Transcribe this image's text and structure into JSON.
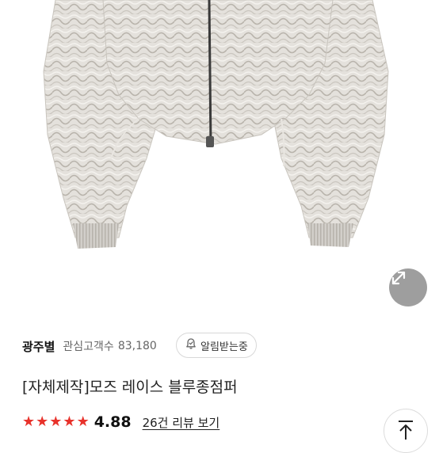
{
  "product_image": {
    "icon": "product-photo"
  },
  "expand_button": {
    "icon": "expand-arrows-icon"
  },
  "seller": {
    "name": "광주별",
    "watcher_label": "관심고객수",
    "watcher_count": "83,180"
  },
  "notify_button": {
    "label": "알림받는중",
    "icon": "bell-check-icon"
  },
  "product": {
    "title": "[자체제작]모즈 레이스 블루종점퍼"
  },
  "rating": {
    "stars": 5,
    "value": "4.88",
    "review_link": "26건 리뷰 보기",
    "star_color": "#e8322b"
  },
  "scroll_top_button": {
    "icon": "arrow-up-to-top-icon"
  }
}
